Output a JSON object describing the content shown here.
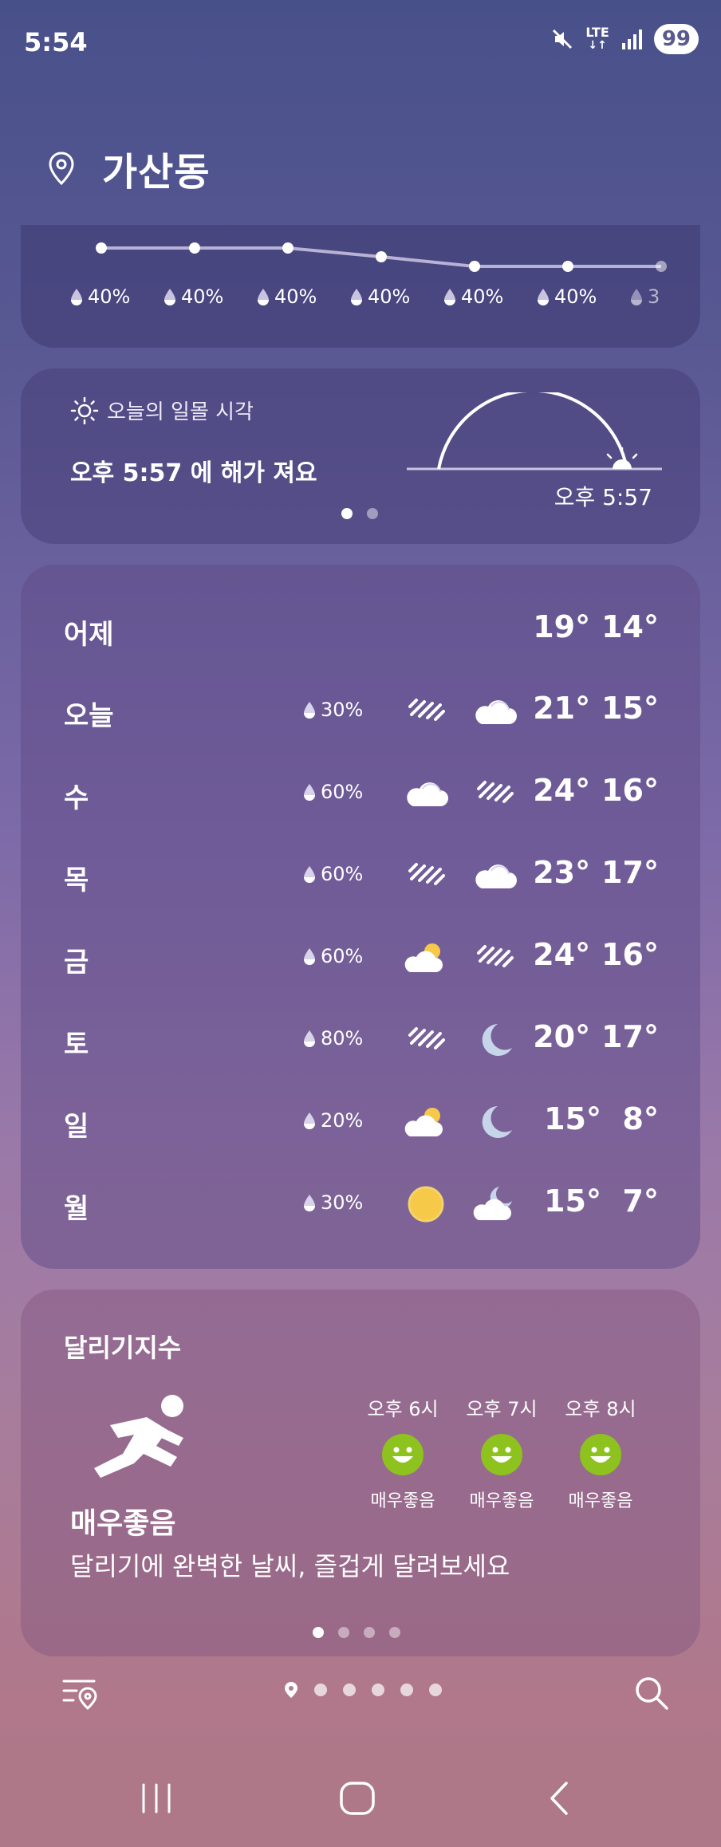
{
  "status_bar": {
    "time": "5:54",
    "network": "LTE",
    "battery": "99"
  },
  "header": {
    "location": "가산동"
  },
  "precip_strip": {
    "items": [
      "40%",
      "40%",
      "40%",
      "40%",
      "40%",
      "40%",
      "3"
    ]
  },
  "sunset": {
    "title": "오늘의 일몰 시각",
    "message": "오후 5:57 에 해가 져요",
    "time": "오후 5:57",
    "page_dots": 2,
    "active_dot": 0
  },
  "weekly": {
    "yesterday": {
      "label": "어제",
      "high": "19°",
      "low": "14°"
    },
    "days": [
      {
        "name": "오늘",
        "precip": "30%",
        "am_icon": "rain-icon",
        "pm_icon": "cloud-icon",
        "high": "21°",
        "low": "15°"
      },
      {
        "name": "수",
        "precip": "60%",
        "am_icon": "cloud-icon",
        "pm_icon": "rain-icon",
        "high": "24°",
        "low": "16°"
      },
      {
        "name": "목",
        "precip": "60%",
        "am_icon": "rain-icon",
        "pm_icon": "cloud-icon",
        "high": "23°",
        "low": "17°"
      },
      {
        "name": "금",
        "precip": "60%",
        "am_icon": "partly-cloudy-icon",
        "pm_icon": "rain-icon",
        "high": "24°",
        "low": "16°"
      },
      {
        "name": "토",
        "precip": "80%",
        "am_icon": "rain-icon",
        "pm_icon": "moon-icon",
        "high": "20°",
        "low": "17°"
      },
      {
        "name": "일",
        "precip": "20%",
        "am_icon": "partly-cloudy-icon",
        "pm_icon": "moon-icon",
        "high": "15°",
        "low": "8°"
      },
      {
        "name": "월",
        "precip": "30%",
        "am_icon": "sun-icon",
        "pm_icon": "cloudy-night-icon",
        "high": "15°",
        "low": "7°"
      }
    ]
  },
  "running": {
    "title": "달리기지수",
    "level": "매우좋음",
    "description": "달리기에 완벽한 날씨, 즐겁게 달려보세요",
    "hours": [
      {
        "time": "오후 6시",
        "label": "매우좋음"
      },
      {
        "time": "오후 7시",
        "label": "매우좋음"
      },
      {
        "time": "오후 8시",
        "label": "매우좋음"
      }
    ],
    "page_dots": 4,
    "active_dot": 0
  },
  "toolbar": {
    "location_pages": 5
  },
  "colors": {
    "accent_green": "#8dc21f",
    "sun_yellow": "#f7c948",
    "moon_blue": "#c7d5ea"
  }
}
